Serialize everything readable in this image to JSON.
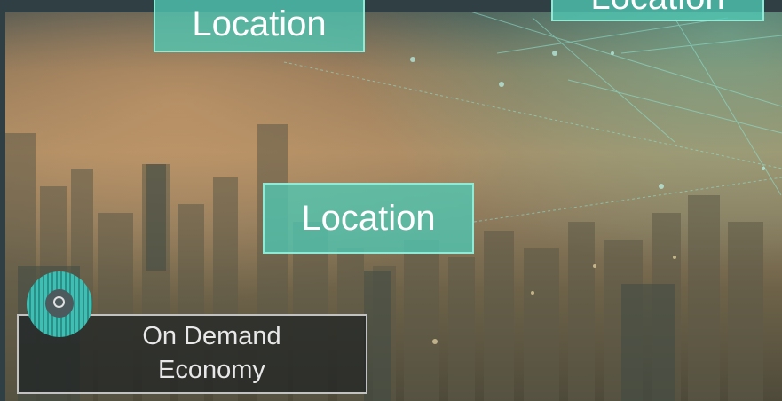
{
  "location_tags": {
    "top_left": "Location",
    "top_right": "Location",
    "center": "Location"
  },
  "badge": {
    "line1": "On Demand",
    "line2": "Economy",
    "icon": "camera-lens-icon"
  },
  "colors": {
    "tag_fill": "#50c8b4",
    "tag_border": "#96f0dc",
    "badge_bg": "#1e2224",
    "icon_teal": "#3fbfb3"
  }
}
